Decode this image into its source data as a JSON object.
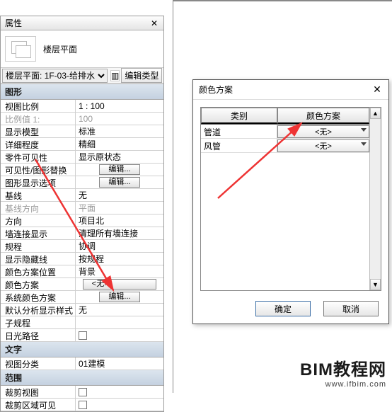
{
  "panel": {
    "title": "属性",
    "type_label": "楼层平面",
    "instance_select": "楼层平面: 1F-03-给排水",
    "edit_type_btn": "编辑类型",
    "sections": {
      "graphics": "图形",
      "text": "文字",
      "extents": "范围"
    },
    "rows": {
      "view_scale_k": "视图比例",
      "view_scale_v": "1 : 100",
      "scale_value_k": "比例值 1:",
      "scale_value_v": "100",
      "display_model_k": "显示模型",
      "display_model_v": "标准",
      "detail_level_k": "详细程度",
      "detail_level_v": "精细",
      "parts_vis_k": "零件可见性",
      "parts_vis_v": "显示原状态",
      "vg_override_k": "可见性/图形替换",
      "vg_btn": "编辑...",
      "graphic_opts_k": "图形显示选项",
      "go_btn": "编辑...",
      "orientation_k": "方向",
      "orientation_v": "项目北",
      "baseline_k": "基线",
      "baseline_v": "无",
      "baseline_dir_k": "基线方向",
      "baseline_dir_v": "平面",
      "wall_join_k": "墙连接显示",
      "wall_join_v": "清理所有墙连接",
      "discipline_k": "规程",
      "discipline_v": "协调",
      "hidden_lines_k": "显示隐藏线",
      "hidden_lines_v": "按规程",
      "scheme_loc_k": "颜色方案位置",
      "scheme_loc_v": "背景",
      "color_scheme_k": "颜色方案",
      "color_scheme_v": "<无>",
      "sys_scheme_k": "系统颜色方案",
      "sys_btn": "编辑...",
      "analysis_style_k": "默认分析显示样式",
      "analysis_style_v": "无",
      "sub_discipline_k": "子规程",
      "sub_discipline_v": "",
      "sun_path_k": "日光路径",
      "view_class_k": "视图分类",
      "view_class_v": "01建模",
      "crop_view_k": "裁剪视图",
      "crop_region_k": "裁剪区域可见"
    }
  },
  "dialog": {
    "title": "颜色方案",
    "col1": "类别",
    "col2": "颜色方案",
    "rows": [
      {
        "cat": "管道",
        "val": "<无>"
      },
      {
        "cat": "风管",
        "val": "<无>"
      }
    ],
    "ok": "确定",
    "cancel": "取消"
  },
  "watermark": {
    "line1": "BIM教程网",
    "line2": "www.ifbim.com"
  }
}
